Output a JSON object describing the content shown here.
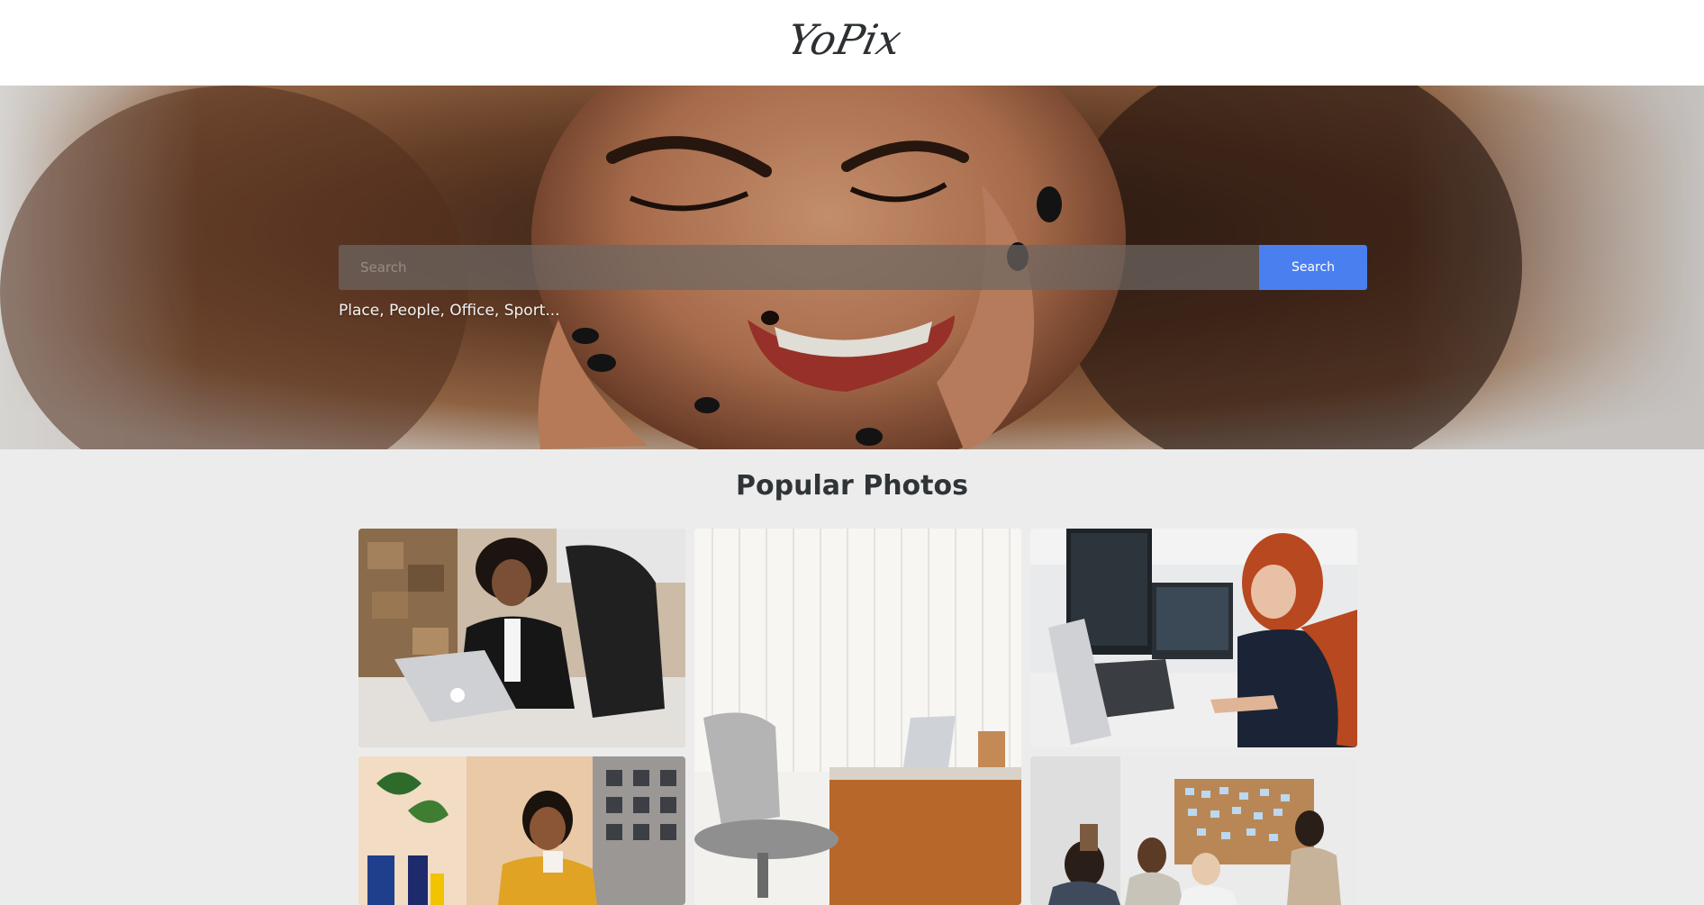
{
  "header": {
    "logo_text": "YoPix"
  },
  "hero": {
    "search": {
      "placeholder": "Search",
      "value": "",
      "button_label": "Search"
    },
    "hint": "Place, People, Office, Sport..."
  },
  "popular": {
    "title": "Popular Photos"
  },
  "colors": {
    "accent": "#4a7ff0",
    "page_bg": "#ececec",
    "header_bg": "#ffffff",
    "title_text": "#2f3437"
  }
}
